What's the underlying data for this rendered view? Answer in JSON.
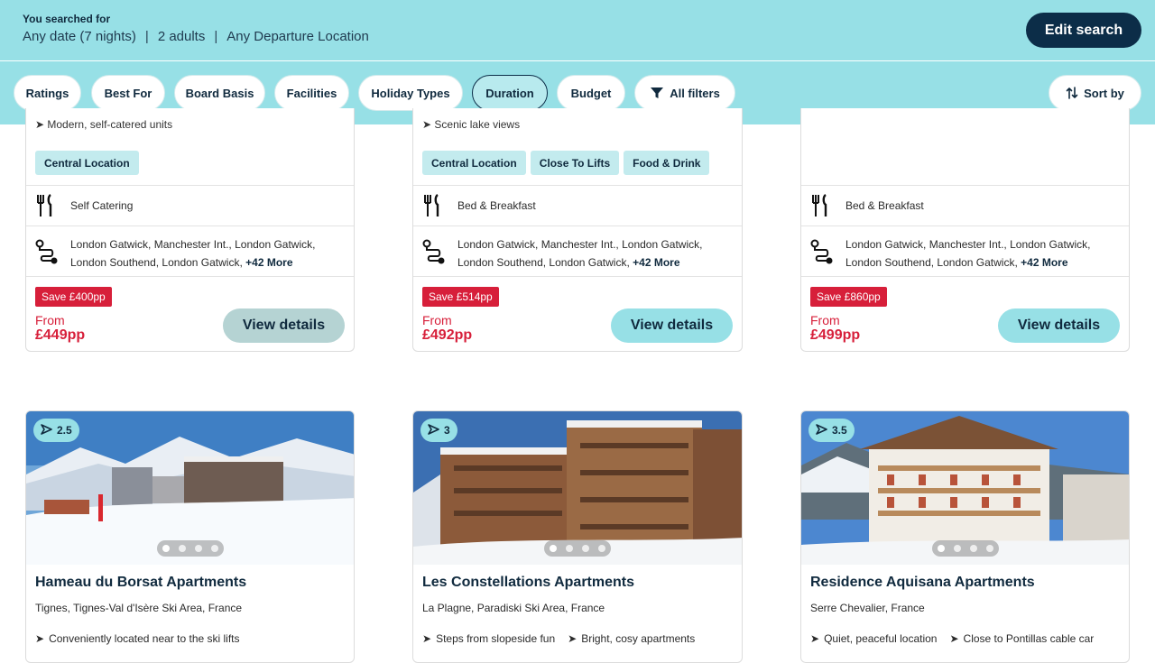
{
  "search": {
    "label": "You searched for",
    "date": "Any date (7 nights)",
    "adults": "2 adults",
    "departure": "Any Departure Location",
    "edit_label": "Edit search",
    "separator": "|"
  },
  "filters": {
    "items": [
      {
        "label": "Ratings"
      },
      {
        "label": "Best For"
      },
      {
        "label": "Board Basis"
      },
      {
        "label": "Facilities"
      },
      {
        "label": "Holiday Types"
      },
      {
        "label": "Duration",
        "active": true
      },
      {
        "label": "Budget"
      },
      {
        "label": "All filters",
        "icon": "funnel-icon"
      }
    ],
    "sort_label": "Sort by"
  },
  "top_cards": [
    {
      "highlight": "Modern, self-catered units",
      "tags": [
        "Central Location"
      ],
      "board": "Self Catering",
      "airports": "London Gatwick, Manchester Int., London Gatwick, London Southend, London Gatwick,",
      "airports_more": "+42 More",
      "save": "Save £400pp",
      "from_label": "From",
      "price": "£449pp",
      "cta": "View details"
    },
    {
      "highlight": "Scenic lake views",
      "tags": [
        "Central Location",
        "Close To Lifts",
        "Food & Drink"
      ],
      "board": "Bed & Breakfast",
      "airports": "London Gatwick, Manchester Int., London Gatwick, London Southend, London Gatwick,",
      "airports_more": "+42 More",
      "save": "Save £514pp",
      "from_label": "From",
      "price": "£492pp",
      "cta": "View details"
    },
    {
      "highlight": "",
      "tags": [],
      "board": "Bed & Breakfast",
      "airports": "London Gatwick, Manchester Int., London Gatwick, London Southend, London Gatwick,",
      "airports_more": "+42 More",
      "save": "Save £860pp",
      "from_label": "From",
      "price": "£499pp",
      "cta": "View details"
    }
  ],
  "bottom_cards": [
    {
      "rating": "2.5",
      "name": "Hameau du Borsat Apartments",
      "location": "Tignes, Tignes-Val d'Isère Ski Area, France",
      "features": [
        "Conveniently located near to the ski lifts"
      ]
    },
    {
      "rating": "3",
      "name": "Les Constellations Apartments",
      "location": "La Plagne, Paradiski Ski Area, France",
      "features": [
        "Steps from slopeside fun",
        "Bright, cosy apartments"
      ]
    },
    {
      "rating": "3.5",
      "name": "Residence Aquisana Apartments",
      "location": "Serre Chevalier, France",
      "features": [
        "Quiet, peaceful location",
        "Close to Pontillas cable car"
      ]
    }
  ],
  "colors": {
    "brand_aqua": "#97e0e6",
    "brand_navy": "#0c2d48",
    "price_red": "#d71f3a"
  }
}
